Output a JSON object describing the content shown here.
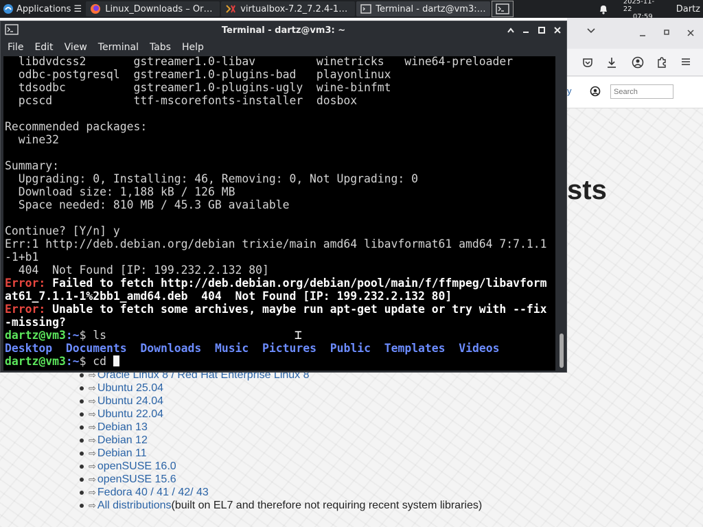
{
  "taskbar": {
    "applications_label": "Applications ☰",
    "tasks": [
      {
        "label": "Linux_Downloads – Ora...",
        "icon": "firefox-icon"
      },
      {
        "label": "virtualbox-7.2_7.2.4-17...",
        "icon": "archive-icon"
      },
      {
        "label": "Terminal - dartz@vm3: ~",
        "icon": "terminal-icon"
      }
    ],
    "date": "2025-11-22",
    "time": "07:59",
    "user": "Dartz"
  },
  "browser": {
    "search_placeholder": "Search",
    "link_fragment": "y",
    "heading_fragment": "sts"
  },
  "terminal": {
    "title": "Terminal - dartz@vm3: ~",
    "menu": [
      "File",
      "Edit",
      "View",
      "Terminal",
      "Tabs",
      "Help"
    ],
    "lines": {
      "pkg1": "  libdvdcss2       gstreamer1.0-libav         winetricks   wine64-preloader",
      "pkg2": "  odbc-postgresql  gstreamer1.0-plugins-bad   playonlinux",
      "pkg3": "  tdsodbc          gstreamer1.0-plugins-ugly  wine-binfmt",
      "pkg4": "  pcscd            ttf-mscorefonts-installer  dosbox",
      "rec_head": "Recommended packages:",
      "rec_pkg": "  wine32",
      "summary": "Summary:",
      "sum1": "  Upgrading: 0, Installing: 46, Removing: 0, Not Upgrading: 0",
      "sum2": "  Download size: 1,188 kB / 126 MB",
      "sum3": "  Space needed: 810 MB / 45.3 GB available",
      "cont": "Continue? [Y/n] y",
      "err1a": "Err:1 http://deb.debian.org/debian trixie/main amd64 libavformat61 amd64 7:7.1.1",
      "err1b": "-1+b1",
      "err1c": "  404  Not Found [IP: 199.232.2.132 80]",
      "error_label": "Error:",
      "err2a": " Failed to fetch http://deb.debian.org/debian/pool/main/f/ffmpeg/libavform",
      "err2b": "at61_7.1.1-1%2bb1_amd64.deb  404  Not Found [IP: 199.232.2.132 80]",
      "err3a": " Unable to fetch some archives, maybe run apt-get update or try with --fix",
      "err3b": "-missing?",
      "prompt_user": "dartz@vm3",
      "prompt_path": ":~",
      "prompt_sym": "$",
      "cmd1": " ls",
      "cmd2": " cd "
    },
    "ls_dirs": [
      "Desktop",
      "Documents",
      "Downloads",
      "Music",
      "Pictures",
      "Public",
      "Templates",
      "Videos"
    ]
  },
  "distro_list": [
    {
      "label": "Oracle Linux 8 / Red Hat Enterprise Linux 8",
      "rest": ""
    },
    {
      "label": "Ubuntu 25.04",
      "rest": ""
    },
    {
      "label": "Ubuntu 24.04",
      "rest": ""
    },
    {
      "label": "Ubuntu 22.04",
      "rest": ""
    },
    {
      "label": "Debian 13",
      "rest": ""
    },
    {
      "label": "Debian 12",
      "rest": ""
    },
    {
      "label": "Debian 11",
      "rest": ""
    },
    {
      "label": "openSUSE 16.0",
      "rest": ""
    },
    {
      "label": "openSUSE 15.6",
      "rest": ""
    },
    {
      "label": "Fedora 40 / 41 / 42/ 43",
      "rest": ""
    },
    {
      "label": "All distributions",
      "rest": " (built on EL7 and therefore not requiring recent system libraries)"
    }
  ],
  "colors": {
    "panel": "#1f2124",
    "terminal_bg": "#000000",
    "prompt": "#5ce65c",
    "dir": "#6c8cff",
    "error": "#e8473f",
    "link": "#2a63a6"
  }
}
